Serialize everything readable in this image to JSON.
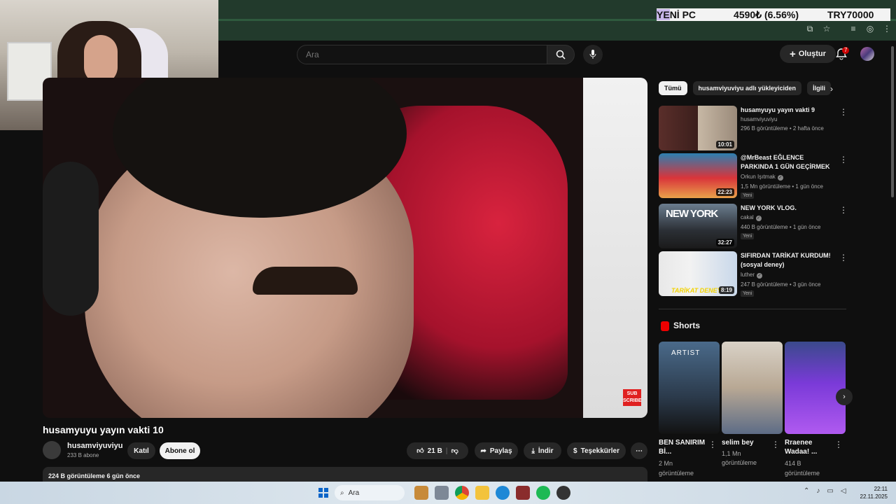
{
  "ticker": {
    "name_highlight": "YE",
    "name_rest": "Nİ PC",
    "value": "4590₺ (6.56%)",
    "target": "TRY70000"
  },
  "header": {
    "search_placeholder": "Ara",
    "create_label": "Oluştur",
    "notification_count": "7"
  },
  "video": {
    "title": "husamyuyu yayın vakti 10",
    "channel": "husamviyuviyu",
    "subscribers": "233 B abone",
    "join_label": "Katıl",
    "subscribe_label": "Abone ol",
    "likes": "21 B",
    "share_label": "Paylaş",
    "download_label": "İndir",
    "thanks_label": "Teşekkürler",
    "description": "224 B görüntüleme  6 gün önce",
    "sub_badge": "SUB SCRIBE"
  },
  "chips": [
    "Tümü",
    "husamviyuviyu adlı yükleyiciden",
    "İlgili"
  ],
  "related": [
    {
      "title": "husamyuyu yayın vakti 9",
      "channel": "husamviyuviyu",
      "verified": false,
      "meta": "296 B görüntüleme • 2 hafta önce",
      "duration": "10:01",
      "new": ""
    },
    {
      "title": "@MrBeast  EĞLENCE PARKINDA 1 GÜN GEÇİRMEK",
      "channel": "Orkun Işıtmak",
      "verified": true,
      "meta": "1,5 Mn görüntüleme • 1 gün önce",
      "duration": "22:23",
      "new": "Yeni"
    },
    {
      "title": "NEW YORK VLOG.",
      "channel": "cakal",
      "verified": true,
      "meta": "440 B görüntüleme • 1 gün önce",
      "duration": "32:27",
      "new": "Yeni"
    },
    {
      "title": "SIFIRDAN TARİKAT KURDUM! (sosyal deney)",
      "channel": "luther",
      "verified": true,
      "meta": "247 B görüntüleme • 3 gün önce",
      "duration": "8:19",
      "new": "Yeni"
    }
  ],
  "thumb_text": {
    "ny": "NEW YORK",
    "tarikat": "TARİKAT DENEY",
    "artist": "ARTIST"
  },
  "shorts": {
    "heading": "Shorts",
    "items": [
      {
        "title": "BEN SANIRIM Bİ...",
        "views_1": "2 Mn",
        "views_2": "görüntüleme"
      },
      {
        "title": "selim bey",
        "views_1": "1,1 Mn",
        "views_2": "görüntüleme"
      },
      {
        "title": "Rraenee Wadaa! ...",
        "views_1": "414 B",
        "views_2": "görüntüleme"
      }
    ]
  },
  "taskbar": {
    "search_label": "Ara",
    "time": "22:11",
    "date": "22.11.2025"
  }
}
